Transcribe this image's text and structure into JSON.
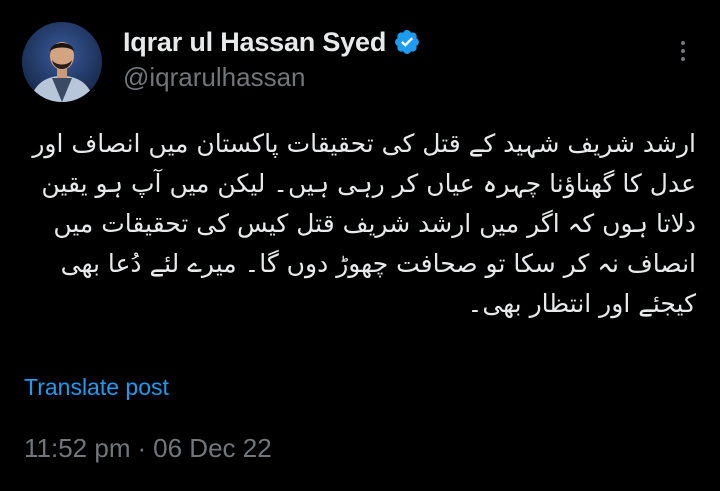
{
  "author": {
    "display_name": "Iqrar ul Hassan Syed",
    "handle": "@iqrarulhassan",
    "verified": true,
    "avatar_icon": "profile-photo"
  },
  "post": {
    "text": "ارشد شریف شہید کے قتل کی تحقیقات پاکستان میں انصاف اور عدل کا گھناؤنا چہرہ عیاں کر رہی ہیں۔ لیکن میں آپ ہو یقین دلاتا ہوں کہ اگر میں ارشد شریف قتل کیس کی تحقیقات میں انصاف نہ کر سکا تو صحافت چھوڑ دوں گا۔ میرے لئے دُعا بھی کیجئے اور انتظار بھی۔",
    "translate_label": "Translate post",
    "time": "11:52 pm",
    "separator": "·",
    "date": "06 Dec 22"
  },
  "icons": {
    "more": "more-horizontal-icon",
    "verified": "verified-badge-icon"
  },
  "colors": {
    "background": "#000000",
    "text_primary": "#e7e9ea",
    "text_secondary": "#71767b",
    "accent": "#1d9bf0"
  }
}
